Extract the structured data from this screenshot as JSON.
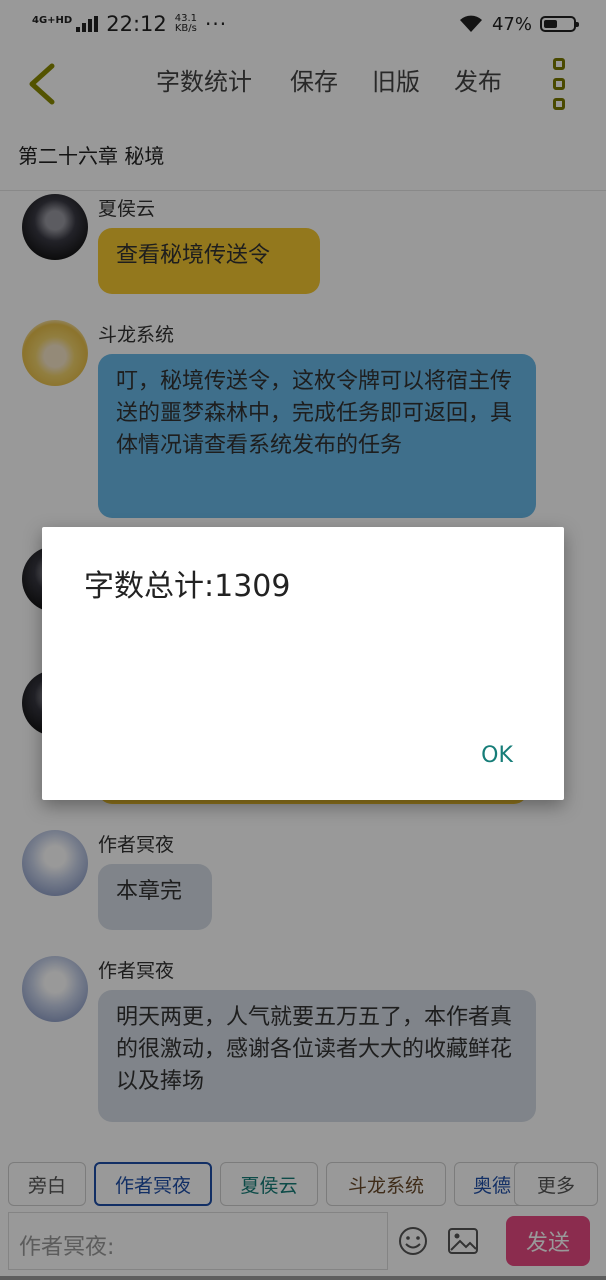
{
  "status_bar": {
    "network": "4G+HD",
    "time": "22:12",
    "speed_value": "43.1",
    "speed_unit": "KB/s",
    "dots": "···",
    "battery": "47%",
    "battery_level": 0.47
  },
  "toolbar": {
    "word_count": "字数统计",
    "save": "保存",
    "old_version": "旧版",
    "publish": "发布"
  },
  "chapter_title": "第二十六章  秘境",
  "messages": [
    {
      "name": "夏侯云",
      "text": "查看秘境传送令",
      "color": "#f5c931"
    },
    {
      "name": "斗龙系统",
      "text": "叮，秘境传送令，这枚令牌可以将宿主传送的噩梦森林中，完成任务即可返回，具体情况请查看系统发布的任务",
      "color": "#69b9e8"
    },
    {
      "name": "作者冥夜",
      "text": "本章完",
      "color": "#d6dde6"
    },
    {
      "name": "作者冥夜",
      "text": "明天两更，人气就要五万五了，本作者真的很激动，感谢各位读者大大的收藏鲜花以及捧场",
      "color": "#d6dde6"
    }
  ],
  "roles": [
    "旁白",
    "作者冥夜",
    "夏侯云",
    "斗龙系统",
    "奥德"
  ],
  "more_button": "更多",
  "input_placeholder": "作者冥夜:",
  "send_button": "发送",
  "dialog": {
    "message": "字数总计:1309",
    "ok": "OK"
  },
  "colors": {
    "accent": "#167d78",
    "send": "#e84a83",
    "selected_role_border": "#1f4fa8"
  }
}
